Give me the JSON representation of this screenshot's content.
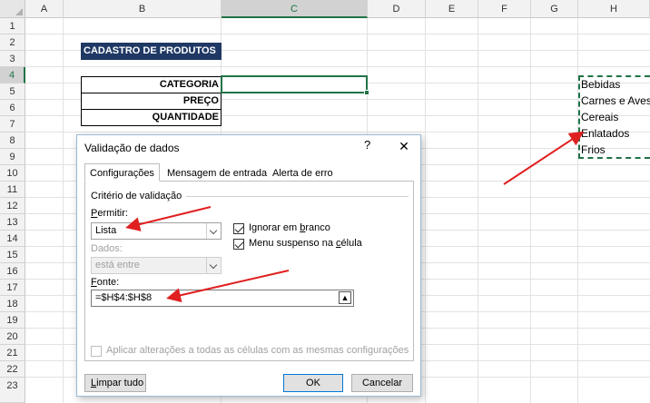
{
  "sheet": {
    "columns": [
      "A",
      "B",
      "C",
      "D",
      "E",
      "F",
      "G",
      "H"
    ],
    "selected_column": "C",
    "rows": [
      "1",
      "2",
      "3",
      "4",
      "5",
      "6",
      "7",
      "8",
      "9",
      "10",
      "11",
      "12",
      "13",
      "14",
      "15",
      "16",
      "17",
      "18",
      "19",
      "20",
      "21",
      "22",
      "23"
    ],
    "selected_row": "4",
    "title": "CADASTRO DE PRODUTOS",
    "labels": [
      "CATEGORIA",
      "PREÇO",
      "QUANTIDADE"
    ],
    "category_list": [
      "Bebidas",
      "Carnes e Aves",
      "Cereais",
      "Enlatados",
      "Frios"
    ]
  },
  "dialog": {
    "title": "Validação de dados",
    "help": "?",
    "close": "✕",
    "tabs": [
      "Configurações",
      "Mensagem de entrada",
      "Alerta de erro"
    ],
    "group_label": "Critério de validação",
    "permit_label_u": "P",
    "permit_label_rest": "ermitir:",
    "permit_value": "Lista",
    "data_label": "Dados:",
    "data_value": "está entre",
    "ignore_blank_pre": "Ignorar em ",
    "ignore_blank_u": "b",
    "ignore_blank_post": "ranco",
    "dropdown_pre": "Menu suspenso na ",
    "dropdown_u": "c",
    "dropdown_post": "élula",
    "source_label_u": "F",
    "source_label_rest": "onte:",
    "source_value": "=$H$4:$H$8",
    "apply_all": "Aplicar alterações a todas as células com as mesmas configurações",
    "clear_all_u": "L",
    "clear_all_rest": "impar tudo",
    "ok": "OK",
    "cancel": "Cancelar",
    "ignore_blank_checked": true,
    "dropdown_checked": true,
    "apply_all_checked": false
  },
  "colors": {
    "title_fill": "#1f3864",
    "excel_green": "#217346",
    "annotation_arrow": "#e02020"
  }
}
